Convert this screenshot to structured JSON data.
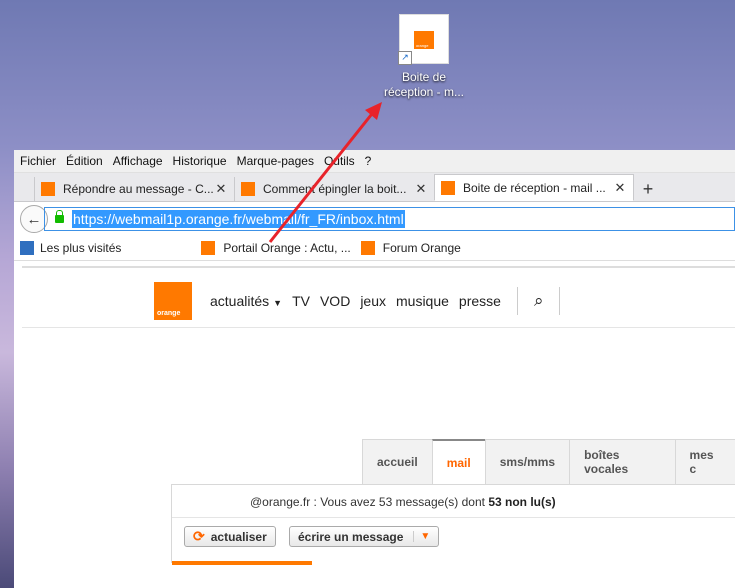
{
  "desktop": {
    "shortcut_label": "Boite de réception - m..."
  },
  "menu": [
    "Fichier",
    "Édition",
    "Affichage",
    "Historique",
    "Marque-pages",
    "Outils",
    "?"
  ],
  "tabs": [
    {
      "title": "Répondre au message - C..."
    },
    {
      "title": "Comment épingler la boit..."
    },
    {
      "title": "Boite de réception - mail ..."
    }
  ],
  "url": "https://webmail1p.orange.fr/webmail/fr_FR/inbox.html",
  "bookmarks": [
    {
      "label": "Les plus visités"
    },
    {
      "label": "Portail Orange : Actu, ..."
    },
    {
      "label": "Forum Orange"
    }
  ],
  "site_nav": {
    "brand": "orange",
    "items": [
      "actualités",
      "TV",
      "VOD",
      "jeux",
      "musique",
      "presse"
    ]
  },
  "mail_tabs": [
    "accueil",
    "mail",
    "sms/mms",
    "boîtes vocales",
    "mes c"
  ],
  "status": {
    "prefix": "@orange.fr : Vous avez 53 message(s) dont ",
    "unread": "53 non lu(s)"
  },
  "buttons": {
    "refresh": "actualiser",
    "compose": "écrire un message"
  },
  "colors": {
    "accent": "#ff7900",
    "url_highlight": "#3399ff",
    "arrow": "#e8232a"
  }
}
